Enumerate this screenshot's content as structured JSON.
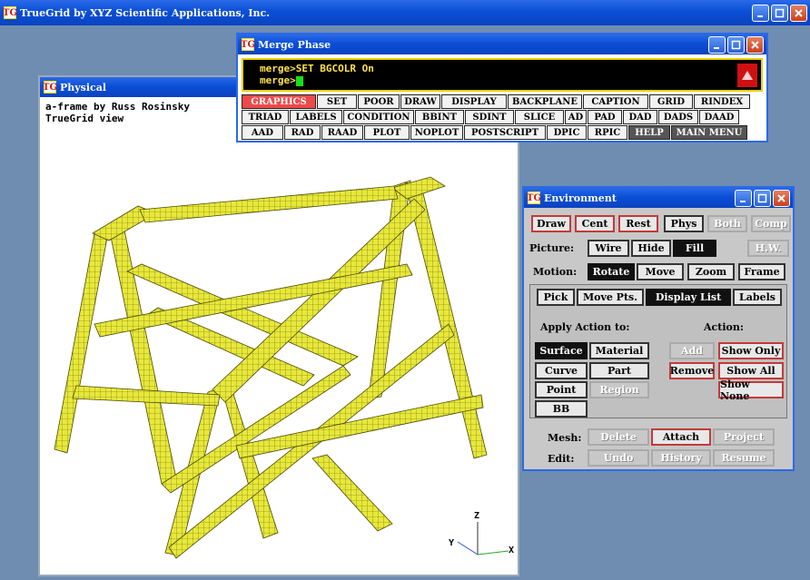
{
  "main_window": {
    "title": "TrueGrid by XYZ Scientific Applications, Inc.",
    "logo": "TG"
  },
  "physical_window": {
    "title": "Physical",
    "lines": [
      "a-frame by Russ Rosinsky",
      "TrueGrid view"
    ],
    "axes": {
      "x": "X",
      "y": "Y",
      "z": "Z"
    }
  },
  "merge_window": {
    "title": "Merge Phase",
    "console_lines": [
      "merge>SET BGCOLR On",
      "merge>"
    ],
    "button_rows": [
      [
        "GRAPHICS",
        "SET",
        "POOR",
        "DRAW",
        "DISPLAY",
        "BACKPLANE",
        "CAPTION",
        "GRID",
        "RINDEX"
      ],
      [
        "TRIAD",
        "LABELS",
        "CONDITION",
        "BBINT",
        "SDINT",
        "SLICE",
        "AD",
        "PAD",
        "DAD",
        "DADS",
        "DAAD"
      ],
      [
        "AAD",
        "RAD",
        "RAAD",
        "PLOT",
        "NOPLOT",
        "POSTSCRIPT",
        "DPIC",
        "RPIC",
        "HELP",
        "MAIN MENU"
      ]
    ]
  },
  "env_window": {
    "title": "Environment",
    "top_buttons": [
      "Draw",
      "Cent",
      "Rest",
      "Phys",
      "Both",
      "Comp"
    ],
    "picture_label": "Picture:",
    "picture_buttons": [
      "Wire",
      "Hide",
      "Fill",
      "H.W."
    ],
    "motion_label": "Motion:",
    "motion_buttons": [
      "Rotate",
      "Move",
      "Zoom",
      "Frame"
    ],
    "mode_buttons": [
      "Pick",
      "Move Pts.",
      "Display List",
      "Labels"
    ],
    "apply_label": "Apply Action to:",
    "action_label": "Action:",
    "apply_buttons": [
      "Surface",
      "Material",
      "Curve",
      "Part",
      "Point",
      "Region",
      "BB"
    ],
    "action_buttons": [
      "Add",
      "Show Only",
      "Remove",
      "Show All",
      "Show None"
    ],
    "mesh_label": "Mesh:",
    "mesh_buttons": [
      "Delete",
      "Attach",
      "Project"
    ],
    "edit_label": "Edit:",
    "edit_buttons": [
      "Undo",
      "History",
      "Resume"
    ]
  },
  "colors": {
    "titlebar": "#0b4fd6",
    "mesh": "#e8e83a",
    "console_text": "#ffe14a",
    "active_button": "#ee4a4a"
  }
}
